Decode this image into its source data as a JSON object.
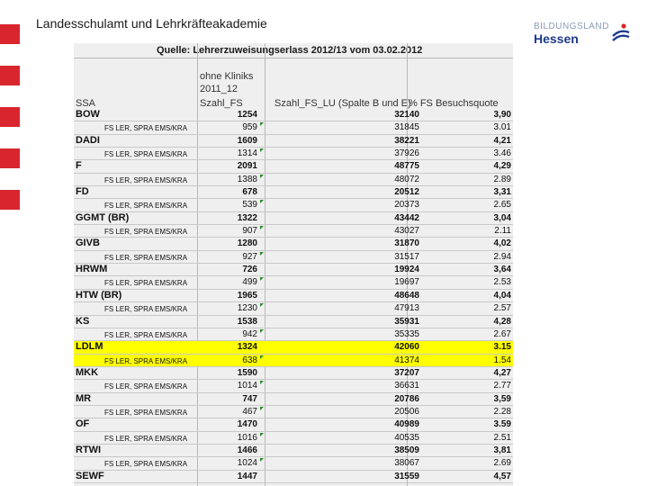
{
  "header": {
    "title": "Landesschulamt und Lehrkräfteakademie"
  },
  "logo": {
    "top_text": "BILDUNGSLAND",
    "bottom_text": "Hessen"
  },
  "table": {
    "caption": "Quelle: Lehrerzuweisungserlass 2012/13 vom 03.02.2012",
    "head_line1": "ohne Kliniks",
    "head_line2": "2011_12",
    "col_ssa": "SSA",
    "col_fs": "Szahl_FS",
    "col_lu": "Szahl_FS_LU (Spalte B und E)",
    "col_quote": "% FS Besuchsquote",
    "rows": [
      {
        "label": "BOW",
        "n1": "1254",
        "n2": "32140",
        "n3": "3,90",
        "kind": "main"
      },
      {
        "label": "FS LER, SPRA  EMS/KRA",
        "n1": "959",
        "n2": "31845",
        "n3": "3.01",
        "kind": "sub"
      },
      {
        "label": "DADI",
        "n1": "1609",
        "n2": "38221",
        "n3": "4,21",
        "kind": "main"
      },
      {
        "label": "FS LER, SPRA  EMS/KRA",
        "n1": "1314",
        "n2": "37926",
        "n3": "3.46",
        "kind": "sub"
      },
      {
        "label": "F",
        "n1": "2091",
        "n2": "48775",
        "n3": "4,29",
        "kind": "main"
      },
      {
        "label": "FS LER, SPRA  EMS/KRA",
        "n1": "1388",
        "n2": "48072",
        "n3": "2.89",
        "kind": "sub"
      },
      {
        "label": "FD",
        "n1": "678",
        "n2": "20512",
        "n3": "3,31",
        "kind": "main"
      },
      {
        "label": "FS LER, SPRA  EMS/KRA",
        "n1": "539",
        "n2": "20373",
        "n3": "2.65",
        "kind": "sub"
      },
      {
        "label": "GGMT (BR)",
        "n1": "1322",
        "n2": "43442",
        "n3": "3,04",
        "kind": "main"
      },
      {
        "label": "FS LER, SPRA  EMS/KRA",
        "n1": "907",
        "n2": "43027",
        "n3": "2.11",
        "kind": "sub"
      },
      {
        "label": "GIVB",
        "n1": "1280",
        "n2": "31870",
        "n3": "4,02",
        "kind": "main"
      },
      {
        "label": "FS LER, SPRA  EMS/KRA",
        "n1": "927",
        "n2": "31517",
        "n3": "2.94",
        "kind": "sub"
      },
      {
        "label": "HRWM",
        "n1": "726",
        "n2": "19924",
        "n3": "3,64",
        "kind": "main"
      },
      {
        "label": "FS LER, SPRA  EMS/KRA",
        "n1": "499",
        "n2": "19697",
        "n3": "2.53",
        "kind": "sub"
      },
      {
        "label": "HTW (BR)",
        "n1": "1965",
        "n2": "48648",
        "n3": "4,04",
        "kind": "main"
      },
      {
        "label": "FS LER, SPRA  EMS/KRA",
        "n1": "1230",
        "n2": "47913",
        "n3": "2.57",
        "kind": "sub"
      },
      {
        "label": "KS",
        "n1": "1538",
        "n2": "35931",
        "n3": "4,28",
        "kind": "main"
      },
      {
        "label": "FS LER, SPRA  EMS/KRA",
        "n1": "942",
        "n2": "35335",
        "n3": "2.67",
        "kind": "sub"
      },
      {
        "label": "LDLM",
        "n1": "1324",
        "n2": "42060",
        "n3": "3.15",
        "kind": "main",
        "hl": true
      },
      {
        "label": "FS LER, SPRA  EMS/KRA",
        "n1": "638",
        "n2": "41374",
        "n3": "1.54",
        "kind": "sub",
        "hl": true
      },
      {
        "label": "MKK",
        "n1": "1590",
        "n2": "37207",
        "n3": "4,27",
        "kind": "main"
      },
      {
        "label": "FS LER, SPRA  EMS/KRA",
        "n1": "1014",
        "n2": "36631",
        "n3": "2.77",
        "kind": "sub"
      },
      {
        "label": "MR",
        "n1": "747",
        "n2": "20786",
        "n3": "3,59",
        "kind": "main"
      },
      {
        "label": "FS LER, SPRA  EMS/KRA",
        "n1": "467",
        "n2": "20506",
        "n3": "2.28",
        "kind": "sub"
      },
      {
        "label": "OF",
        "n1": "1470",
        "n2": "40989",
        "n3": "3.59",
        "kind": "main"
      },
      {
        "label": "FS LER, SPRA  EMS/KRA",
        "n1": "1016",
        "n2": "40535",
        "n3": "2.51",
        "kind": "sub"
      },
      {
        "label": "RTWI",
        "n1": "1466",
        "n2": "38509",
        "n3": "3,81",
        "kind": "main"
      },
      {
        "label": "FS LER, SPRA  EMS/KRA",
        "n1": "1024",
        "n2": "38067",
        "n3": "2.69",
        "kind": "sub"
      },
      {
        "label": "SEWF",
        "n1": "1447",
        "n2": "31559",
        "n3": "4,57",
        "kind": "main"
      }
    ]
  }
}
